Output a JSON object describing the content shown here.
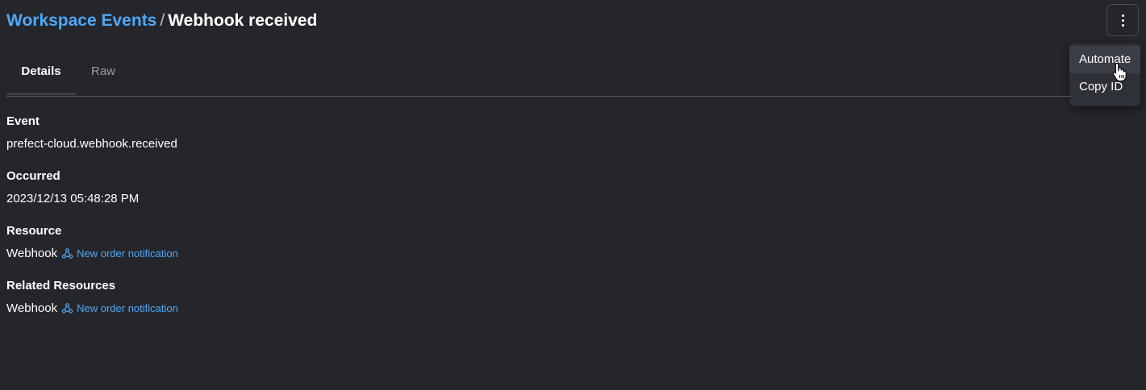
{
  "header": {
    "breadcrumb_link": "Workspace Events",
    "separator": "/",
    "title": "Webhook received"
  },
  "menu": {
    "button_icon": "kebab-vertical-icon",
    "items": [
      {
        "label": "Automate"
      },
      {
        "label": "Copy ID"
      }
    ]
  },
  "tabs": [
    {
      "label": "Details"
    },
    {
      "label": "Raw"
    }
  ],
  "details": {
    "event": {
      "label": "Event",
      "value": "prefect-cloud.webhook.received"
    },
    "occurred": {
      "label": "Occurred",
      "value": "2023/12/13 05:48:28 PM"
    },
    "resource": {
      "label": "Resource",
      "type": "Webhook",
      "link": "New order notification",
      "icon": "webhook-icon"
    },
    "related_resources": {
      "label": "Related Resources",
      "type": "Webhook",
      "link": "New order notification",
      "icon": "webhook-icon"
    }
  },
  "colors": {
    "background": "#25262b",
    "link": "#4ea8f7",
    "text": "#ffffff",
    "muted": "#9a9ca5"
  }
}
